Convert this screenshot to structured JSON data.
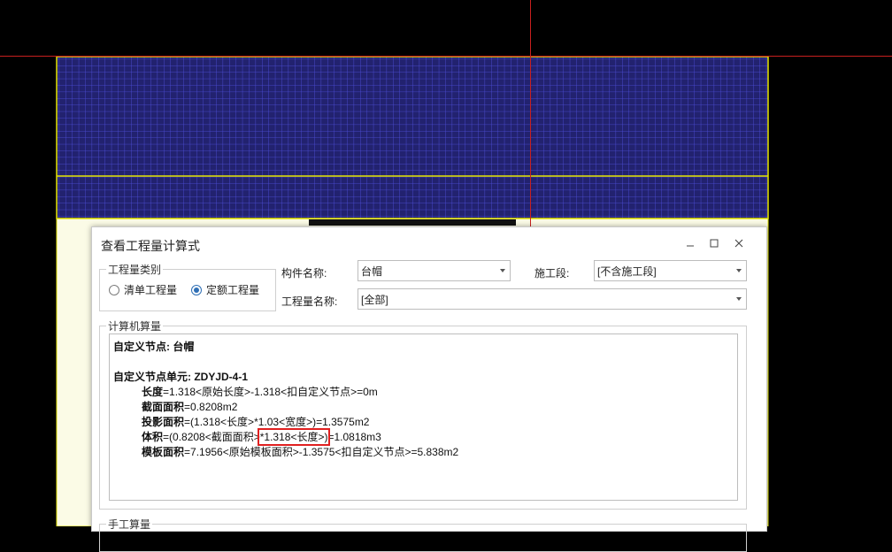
{
  "colors": {
    "canvas_bg": "#000000",
    "grid_fill": "#22226f",
    "grid_line": "#5050e0",
    "outline": "#e6e600",
    "crosshair": "#c8201e",
    "highlight": "#e02020",
    "radio_accent": "#2f6fb5"
  },
  "dialog": {
    "title": "查看工程量计算式",
    "controls": {
      "minimize": "minimize-icon",
      "maximize": "maximize-icon",
      "close": "close-icon"
    },
    "category_group": {
      "legend": "工程量类别",
      "options": [
        {
          "label": "清单工程量",
          "selected": false
        },
        {
          "label": "定额工程量",
          "selected": true
        }
      ]
    },
    "fields": {
      "component_name": {
        "label": "构件名称:",
        "value": "台帽"
      },
      "construction_stage": {
        "label": "施工段:",
        "value": "[不含施工段]"
      },
      "quantity_name": {
        "label": "工程量名称:",
        "value": "[全部]"
      }
    },
    "computed": {
      "legend": "计算机算量",
      "node_title_label": "自定义节点:",
      "node_title_value": "台帽",
      "unit_label": "自定义节点单元:",
      "unit_value": "ZDYJD-4-1",
      "lines": [
        {
          "name": "长度",
          "formula": "=1.318<原始长度>-1.318<扣自定义节点>=0m"
        },
        {
          "name": "截面面积",
          "formula": "=0.8208m2"
        },
        {
          "name": "投影面积",
          "formula": "=(1.318<长度>*1.03<宽度>)=1.3575m2"
        },
        {
          "name": "体积",
          "formula_pre": "=(0.8208<截面面积>",
          "formula_hl": "*1.318<长度>)",
          "formula_post": "=1.0818m3"
        },
        {
          "name": "模板面积",
          "formula": "=7.1956<原始模板面积>-1.3575<扣自定义节点>=5.838m2"
        }
      ]
    },
    "manual": {
      "legend": "手工算量"
    }
  }
}
